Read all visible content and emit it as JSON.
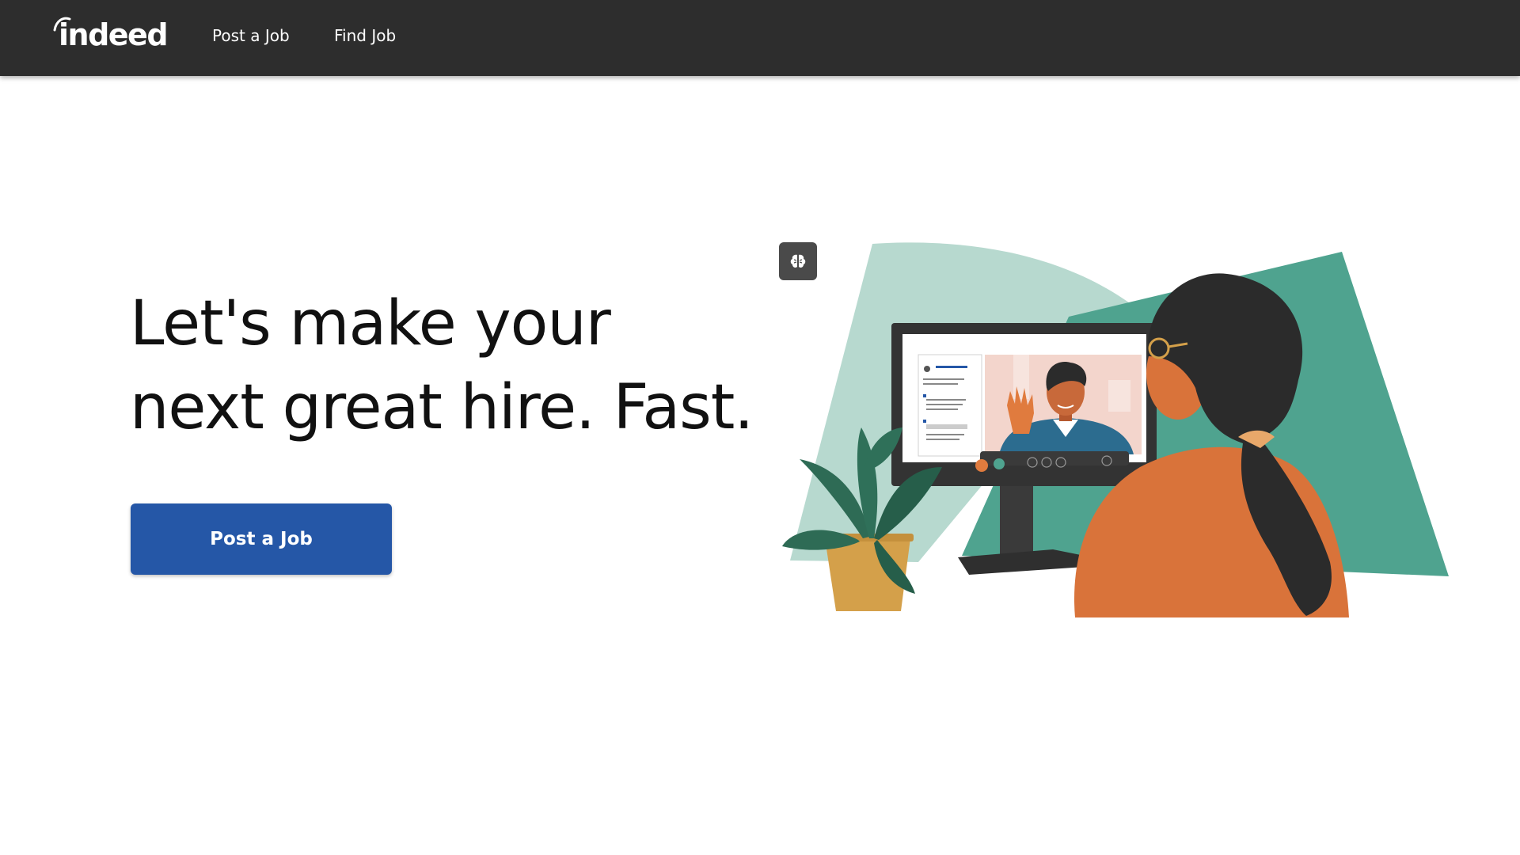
{
  "brand": {
    "logo_text": "indeed"
  },
  "nav": {
    "items": [
      {
        "label": "Post a Job"
      },
      {
        "label": "Find Job"
      }
    ]
  },
  "hero": {
    "title_line1": "Let's make your",
    "title_line2": "next great hire. Fast.",
    "cta_label": "Post a Job"
  },
  "icons": {
    "ai_badge": "brain-icon"
  },
  "colors": {
    "navbar": "#2d2d2d",
    "cta": "#2557a7",
    "shape_light": "#b7d9cf",
    "shape_dark": "#4fa38f",
    "sweater": "#d9733a",
    "hair": "#2b2b2b"
  }
}
